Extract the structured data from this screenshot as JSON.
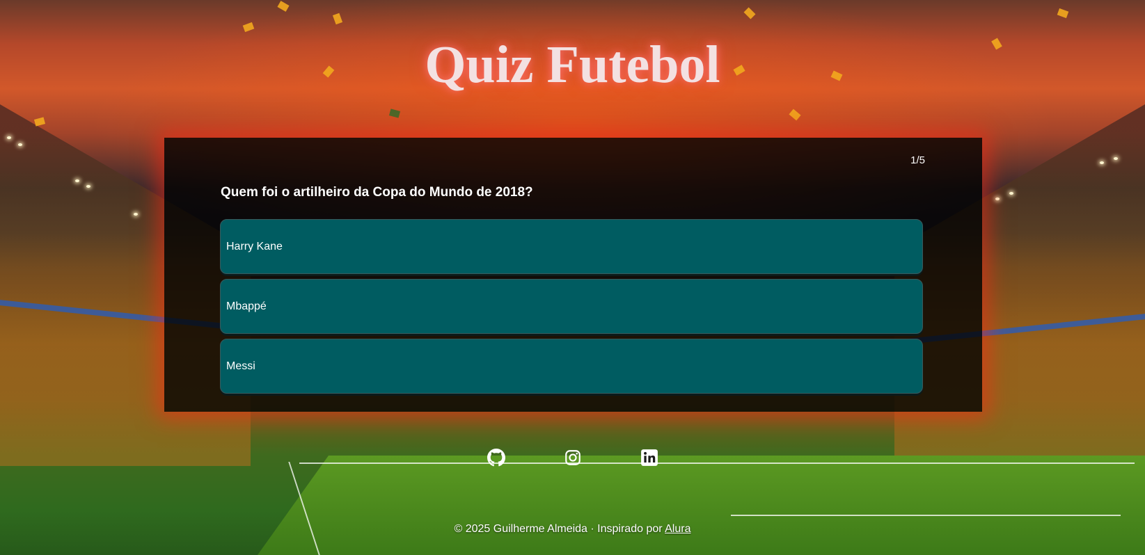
{
  "title": "Quiz Futebol",
  "quiz": {
    "counter": "1/5",
    "question": "Quem foi o artilheiro da Copa do Mundo de 2018?",
    "answers": [
      {
        "label": "Harry Kane"
      },
      {
        "label": "Mbappé"
      },
      {
        "label": "Messi"
      }
    ]
  },
  "social": {
    "icons": [
      "github-icon",
      "instagram-icon",
      "linkedin-icon"
    ]
  },
  "footer": {
    "text": "© 2025 Guilherme Almeida · Inspirado por ",
    "link_label": "Alura"
  },
  "colors": {
    "answer_bg": "#005c61",
    "title_text": "#f3e1e2",
    "panel_glow": "#ff2814"
  }
}
